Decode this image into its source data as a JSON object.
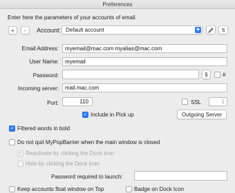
{
  "window": {
    "title": "Preferences"
  },
  "intro": "Enter here the parameters of your accounts of email.",
  "account": {
    "add_label": "+",
    "remove_label": "-",
    "label": "Account:",
    "selected": "Default account"
  },
  "form": {
    "email_label": "Email Address:",
    "email_value": "myemail@mac.com myalias@mac.com",
    "username_label": "User Name:",
    "username_value": "myemail",
    "password_label": "Password:",
    "password_value": "",
    "paragraph_button": "§",
    "hash_label": "#",
    "server_label": "Incoming server:",
    "server_value": "mail.mac.com",
    "port_label": "Port:",
    "port_value": "110",
    "ssl_label": "SSL",
    "ssl_value": "1",
    "include_pickup_label": "Include in Pick up",
    "outgoing_server_button": "Outgoing Server"
  },
  "options": {
    "filtered_bold": "Filtered words in bold",
    "do_not_quit": "Do not quit MyPopBarrier when the main window is closed",
    "reactivate": "Reactivate by clicking the Dock Icon",
    "hide": "Hide by clicking the Dock Icon",
    "password_launch_label": "Password required to launch:",
    "password_launch_value": "",
    "keep_float": "Keep accounts float window on Top",
    "badge": "Badge on Dock Icon"
  },
  "checks": {
    "hash": false,
    "ssl": false,
    "include_pickup": true,
    "filtered_bold": true,
    "do_not_quit": false,
    "reactivate": true,
    "hide": false,
    "keep_float": false,
    "badge": false
  },
  "colors": {
    "accent": "#2a7cf6",
    "window_bg": "#ececec"
  }
}
